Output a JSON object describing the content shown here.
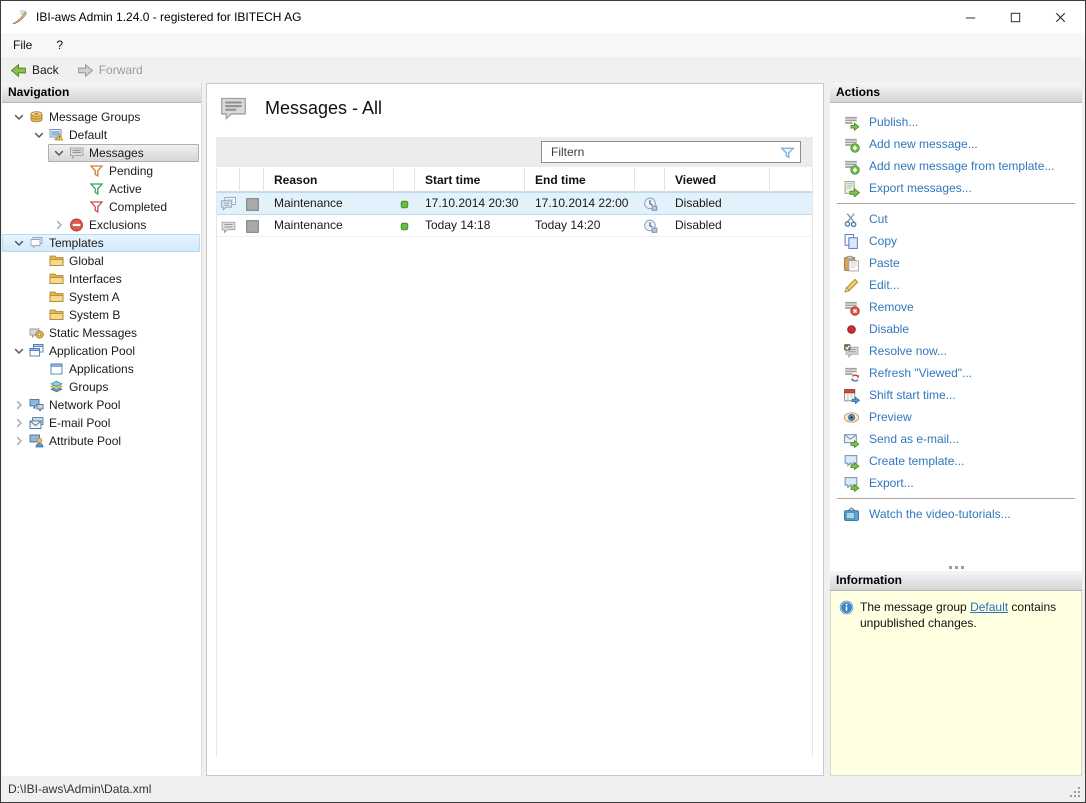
{
  "window": {
    "title": "IBI-aws Admin 1.24.0 - registered for IBITECH AG"
  },
  "menubar": {
    "items": [
      {
        "label": "File"
      },
      {
        "label": "?"
      }
    ]
  },
  "toolbar": {
    "back_label": "Back",
    "forward_label": "Forward"
  },
  "navigation": {
    "header": "Navigation",
    "tree": [
      {
        "label": "Message Groups",
        "level": 0,
        "chevron": "expanded",
        "icon": "message-groups"
      },
      {
        "label": "Default",
        "level": 1,
        "chevron": "expanded",
        "icon": "default-group"
      },
      {
        "label": "Messages",
        "level": 2,
        "chevron": "expanded",
        "icon": "messages",
        "state": "selected"
      },
      {
        "label": "Pending",
        "level": 3,
        "chevron": "none",
        "icon": "funnel-orange"
      },
      {
        "label": "Active",
        "level": 3,
        "chevron": "none",
        "icon": "funnel-green"
      },
      {
        "label": "Completed",
        "level": 3,
        "chevron": "none",
        "icon": "funnel-red"
      },
      {
        "label": "Exclusions",
        "level": 2,
        "chevron": "collapsed",
        "icon": "exclusions"
      },
      {
        "label": "Templates",
        "level": 0,
        "chevron": "expanded",
        "icon": "templates",
        "state": "highlighted"
      },
      {
        "label": "Global",
        "level": 1,
        "chevron": "none",
        "icon": "folder"
      },
      {
        "label": "Interfaces",
        "level": 1,
        "chevron": "none",
        "icon": "folder"
      },
      {
        "label": "System A",
        "level": 1,
        "chevron": "none",
        "icon": "folder"
      },
      {
        "label": "System B",
        "level": 1,
        "chevron": "none",
        "icon": "folder"
      },
      {
        "label": "Static Messages",
        "level": 0,
        "chevron": "none",
        "icon": "static-messages"
      },
      {
        "label": "Application Pool",
        "level": 0,
        "chevron": "expanded",
        "icon": "application-pool"
      },
      {
        "label": "Applications",
        "level": 1,
        "chevron": "none",
        "icon": "applications"
      },
      {
        "label": "Groups",
        "level": 1,
        "chevron": "none",
        "icon": "groups"
      },
      {
        "label": "Network Pool",
        "level": 0,
        "chevron": "collapsed",
        "icon": "network-pool"
      },
      {
        "label": "E-mail Pool",
        "level": 0,
        "chevron": "collapsed",
        "icon": "email-pool"
      },
      {
        "label": "Attribute Pool",
        "level": 0,
        "chevron": "collapsed",
        "icon": "attribute-pool"
      }
    ]
  },
  "main": {
    "title": "Messages - All",
    "filter": {
      "placeholder": "Filtern"
    },
    "table": {
      "columns": [
        "Reason",
        "Start time",
        "End time",
        "Viewed"
      ],
      "rows": [
        {
          "reason": "Maintenance",
          "start_time": "17.10.2014 20:30",
          "end_time": "17.10.2014 22:00",
          "viewed": "Disabled",
          "selected": true
        },
        {
          "reason": "Maintenance",
          "start_time": "Today 14:18",
          "end_time": "Today 14:20",
          "viewed": "Disabled",
          "selected": false
        }
      ]
    }
  },
  "actions": {
    "header": "Actions",
    "items": [
      {
        "label": "Publish...",
        "icon": "publish-icon"
      },
      {
        "label": "Add new message...",
        "icon": "add-message-icon"
      },
      {
        "label": "Add new message from template...",
        "icon": "add-message-icon"
      },
      {
        "label": "Export messages...",
        "icon": "export-messages-icon"
      },
      {
        "label": "Cut",
        "icon": "cut-icon"
      },
      {
        "label": "Copy",
        "icon": "copy-icon"
      },
      {
        "label": "Paste",
        "icon": "paste-icon"
      },
      {
        "label": "Edit...",
        "icon": "edit-icon"
      },
      {
        "label": "Remove",
        "icon": "remove-icon"
      },
      {
        "label": "Disable",
        "icon": "disable-icon"
      },
      {
        "label": "Resolve now...",
        "icon": "resolve-icon"
      },
      {
        "label": "Refresh \"Viewed\"...",
        "icon": "refresh-icon"
      },
      {
        "label": "Shift start time...",
        "icon": "shift-time-icon"
      },
      {
        "label": "Preview",
        "icon": "preview-icon"
      },
      {
        "label": "Send as e-mail...",
        "icon": "send-email-icon"
      },
      {
        "label": "Create template...",
        "icon": "create-template-icon"
      },
      {
        "label": "Export...",
        "icon": "export-icon"
      },
      {
        "label": "Watch the video-tutorials...",
        "icon": "video-tutorials-icon"
      }
    ]
  },
  "information": {
    "header": "Information",
    "text_before_link": "The message group ",
    "link_text": "Default",
    "text_after_link": " contains unpublished changes."
  },
  "statusbar": {
    "path": "D:\\IBI-aws\\Admin\\Data.xml"
  },
  "colors": {
    "action_link": "#3177bd",
    "info_panel_bg": "#ffffe1",
    "selected_row_bg": "#e3f1fb",
    "status_dot_green": "#6abf4b"
  }
}
